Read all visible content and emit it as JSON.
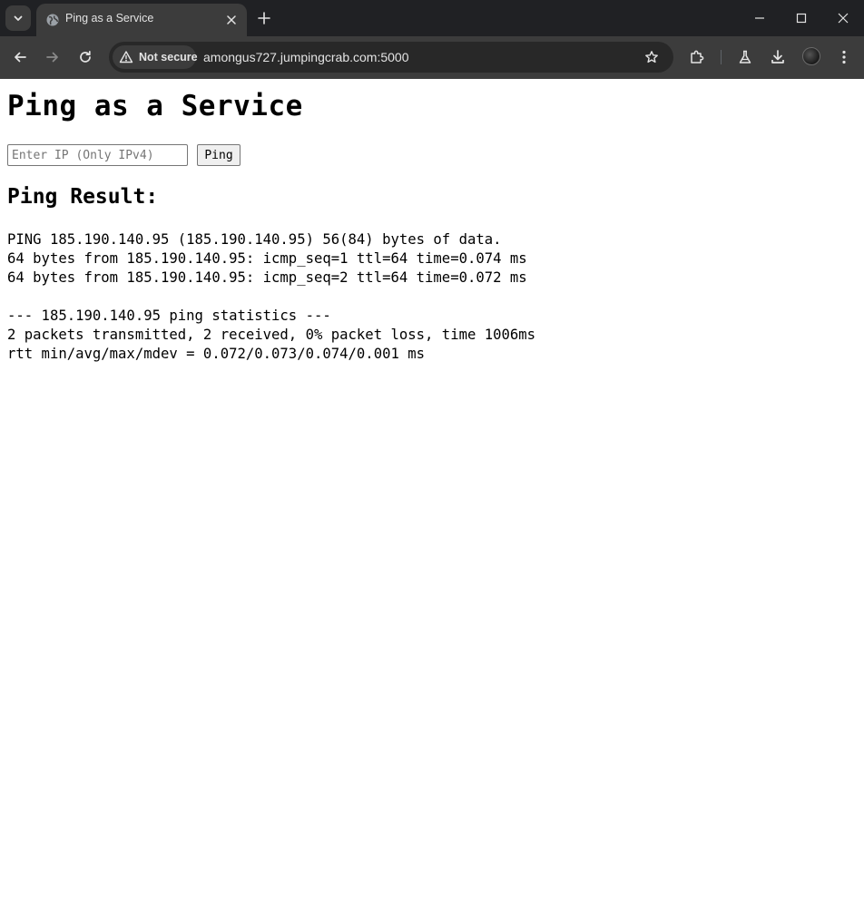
{
  "browser": {
    "tab": {
      "title": "Ping as a Service",
      "favicon": "globe-icon"
    },
    "address_bar": {
      "security_label": "Not secure",
      "url": "amongus727.jumpingcrab.com:5000"
    },
    "theme": {
      "frame_color": "#202124",
      "toolbar_color": "#3c3c3c",
      "omnibox_color": "#282828",
      "icon_color": "#e3e3e3"
    }
  },
  "page": {
    "title": "Ping as a Service",
    "ip_input": {
      "placeholder": "Enter IP (Only IPv4)",
      "value": ""
    },
    "ping_button_label": "Ping",
    "result_heading": "Ping Result:",
    "result_lines": [
      "PING 185.190.140.95 (185.190.140.95) 56(84) bytes of data.",
      "64 bytes from 185.190.140.95: icmp_seq=1 ttl=64 time=0.074 ms",
      "64 bytes from 185.190.140.95: icmp_seq=2 ttl=64 time=0.072 ms",
      "",
      "--- 185.190.140.95 ping statistics ---",
      "2 packets transmitted, 2 received, 0% packet loss, time 1006ms",
      "rtt min/avg/max/mdev = 0.072/0.073/0.074/0.001 ms"
    ]
  }
}
